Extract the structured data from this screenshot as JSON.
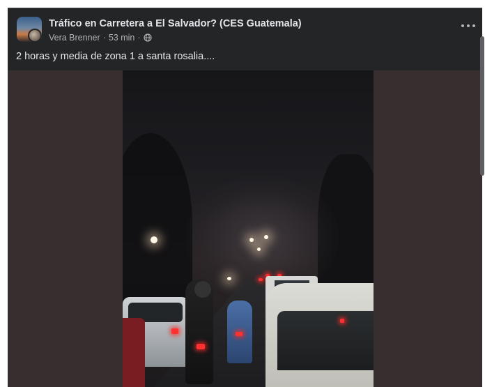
{
  "post": {
    "group_name": "Tráfico en Carretera a El Salvador? (CES Guatemala)",
    "author": "Vera Brenner",
    "separator": "·",
    "time": "53 min",
    "privacy_icon": "globe-icon",
    "more_icon": "more-options-icon",
    "text": "2 horas y media de zona 1 a santa rosalia...."
  },
  "media": {
    "type": "video-still",
    "description_icon": "night-traffic-video"
  },
  "colors": {
    "card_bg": "#242526",
    "media_bg": "#372e2f",
    "primary_text": "#e4e6eb",
    "secondary_text": "#b0b3b8"
  }
}
